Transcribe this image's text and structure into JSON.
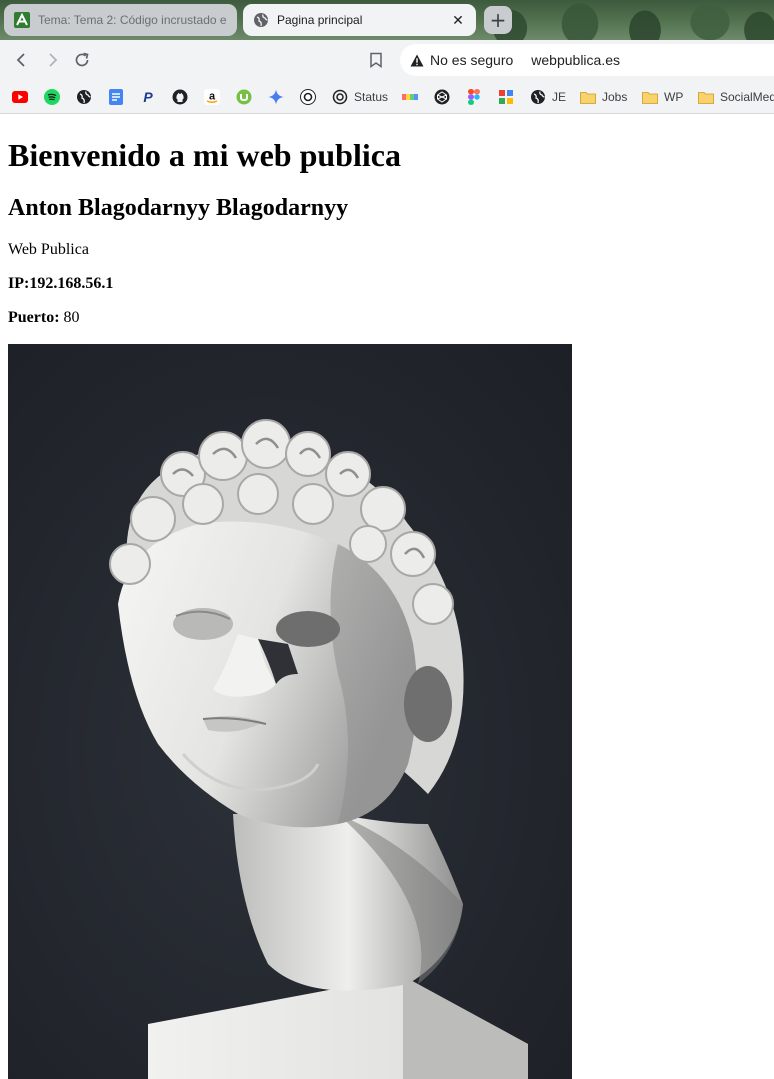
{
  "browser": {
    "tabs": [
      {
        "title": "Tema: Tema 2: Código incrustado en",
        "active": false,
        "icon": "moodle-icon"
      },
      {
        "title": "Pagina principal",
        "active": true,
        "icon": "globe-icon"
      }
    ],
    "new_tab_label": "+",
    "address_bar": {
      "security_text": "No es seguro",
      "url": "webpublica.es"
    },
    "bookmarks": [
      {
        "icon": "youtube-icon",
        "label": ""
      },
      {
        "icon": "spotify-icon",
        "label": ""
      },
      {
        "icon": "globe-icon",
        "label": ""
      },
      {
        "icon": "docs-icon",
        "label": ""
      },
      {
        "icon": "paypal-icon",
        "label": ""
      },
      {
        "icon": "github-icon",
        "label": ""
      },
      {
        "icon": "amazon-icon",
        "label": ""
      },
      {
        "icon": "utorrent-icon",
        "label": ""
      },
      {
        "icon": "gemini-icon",
        "label": ""
      },
      {
        "icon": "openai-icon",
        "label": ""
      },
      {
        "icon": "openai-icon",
        "label": "Status"
      },
      {
        "icon": "colors-icon",
        "label": ""
      },
      {
        "icon": "codepen-icon",
        "label": ""
      },
      {
        "icon": "figma-icon",
        "label": ""
      },
      {
        "icon": "blocks-icon",
        "label": ""
      },
      {
        "icon": "globe-icon",
        "label": "JE"
      },
      {
        "icon": "folder-icon",
        "label": "Jobs"
      },
      {
        "icon": "folder-icon",
        "label": "WP"
      },
      {
        "icon": "folder-icon",
        "label": "SocialMed"
      }
    ],
    "colors": {
      "accent": "#1a73e8",
      "chrome_bg": "#f1f3f4"
    }
  },
  "page": {
    "heading": "Bienvenido a mi web publica",
    "subheading": "Anton Blagodarnyy Blagodarnyy",
    "description": "Web Publica",
    "ip_line": "IP:192.168.56.1",
    "port_label": "Puerto:",
    "port_value": "80",
    "image": {
      "subject": "white marble statue bust on dark background",
      "bg_color": "#23272d"
    }
  }
}
